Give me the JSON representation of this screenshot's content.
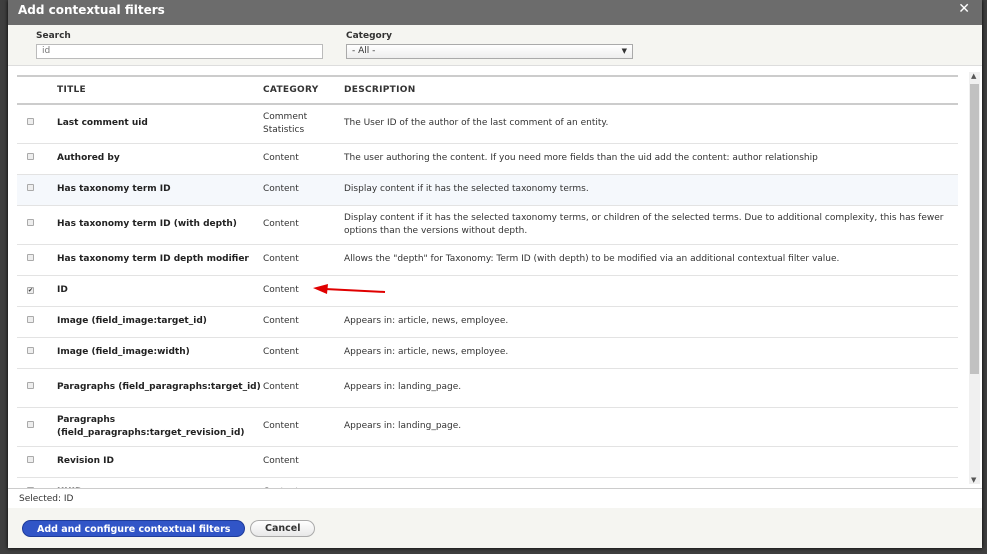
{
  "dialog": {
    "title": "Add contextual filters",
    "close_icon": "close-icon"
  },
  "filters": {
    "search_label": "Search",
    "search_value": "id",
    "category_label": "Category",
    "category_value": "- All -"
  },
  "table": {
    "headers": [
      "TITLE",
      "CATEGORY",
      "DESCRIPTION"
    ],
    "rows": [
      {
        "title": "Last comment uid",
        "category": "Comment Statistics",
        "description": "The User ID of the author of the last comment of an entity.",
        "checked": false
      },
      {
        "title": "Authored by",
        "category": "Content",
        "description": "The user authoring the content. If you need more fields than the uid add the content: author relationship",
        "checked": false
      },
      {
        "title": "Has taxonomy term ID",
        "category": "Content",
        "description": "Display content if it has the selected taxonomy terms.",
        "checked": false
      },
      {
        "title": "Has taxonomy term ID (with depth)",
        "category": "Content",
        "description": "Display content if it has the selected taxonomy terms, or children of the selected terms. Due to additional complexity, this has fewer options than the versions without depth.",
        "checked": false
      },
      {
        "title": "Has taxonomy term ID depth modifier",
        "category": "Content",
        "description": "Allows the \"depth\" for Taxonomy: Term ID (with depth) to be modified via an additional contextual filter value.",
        "checked": false
      },
      {
        "title": "ID",
        "category": "Content",
        "description": "",
        "checked": true
      },
      {
        "title": "Image (field_image:target_id)",
        "category": "Content",
        "description": "Appears in: article, news, employee.",
        "checked": false
      },
      {
        "title": "Image (field_image:width)",
        "category": "Content",
        "description": "Appears in: article, news, employee.",
        "checked": false
      },
      {
        "title": "Paragraphs (field_paragraphs:target_id)",
        "category": "Content",
        "description": "Appears in: landing_page.",
        "checked": false
      },
      {
        "title": "Paragraphs (field_paragraphs:target_revision_id)",
        "category": "Content",
        "description": "Appears in: landing_page.",
        "checked": false
      },
      {
        "title": "Revision ID",
        "category": "Content",
        "description": "",
        "checked": false
      },
      {
        "title": "UUID",
        "category": "Content",
        "description": "",
        "checked": false
      }
    ]
  },
  "selected_text": "Selected: ID",
  "buttons": {
    "primary": "Add and configure contextual filters",
    "cancel": "Cancel"
  },
  "colors": {
    "primary": "#3155c7",
    "arrow": "#e00000",
    "titlebar": "#6c6c6c"
  }
}
